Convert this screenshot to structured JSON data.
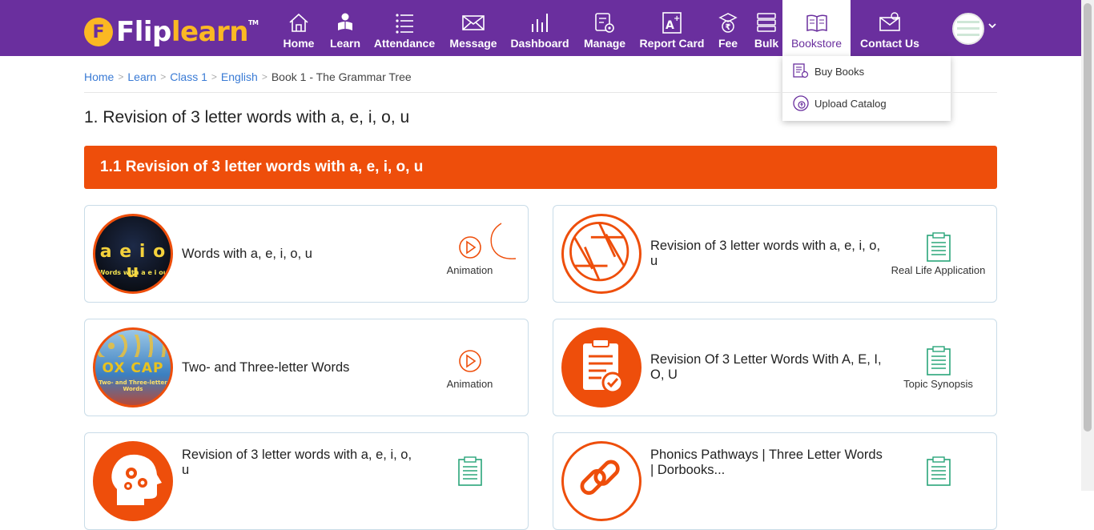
{
  "brand": {
    "flip": "Flip",
    "learn": "learn",
    "tm": "TM"
  },
  "nav": {
    "home": "Home",
    "learn": "Learn",
    "attendance": "Attendance",
    "message": "Message",
    "dashboard": "Dashboard",
    "manage": "Manage",
    "report_card": "Report Card",
    "fee": "Fee",
    "bulk": "Bulk",
    "bookstore": "Bookstore",
    "contact_us": "Contact Us"
  },
  "bookstore_menu": {
    "buy_books": "Buy Books",
    "upload_catalog": "Upload Catalog"
  },
  "breadcrumb": [
    "Home",
    "Learn",
    "Class 1",
    "English",
    "Book 1 - The Grammar Tree"
  ],
  "page_title": "1. Revision of 3 letter words with a, e, i, o, u",
  "section_title": "1.1 Revision of 3 letter words with a, e, i, o, u",
  "cards": [
    {
      "title": "Words with a, e, i, o, u",
      "action": "Animation",
      "thumb_letters": "a e i o u",
      "thumb_caption": "Words with a e i ou"
    },
    {
      "title": "Revision of 3 letter words with a, e, i, o, u",
      "action": "Real Life Application"
    },
    {
      "title": "Two- and Three-letter Words",
      "action": "Animation",
      "thumb_letters": "OX CAP",
      "thumb_caption": "Two- and Three-letter Words"
    },
    {
      "title": "Revision Of 3 Letter Words With A, E, I, O, U",
      "action": "Topic Synopsis"
    },
    {
      "title": "Revision of 3 letter words with a, e, i, o, u",
      "action": ""
    },
    {
      "title": "Phonics Pathways | Three Letter Words | Dorbooks...",
      "action": ""
    }
  ],
  "colors": {
    "nav_bg": "#6a2f9e",
    "accent_orange": "#ee4e0b",
    "link_blue": "#3a7bd5",
    "logo_yellow": "#fbb823",
    "doc_green": "#2aa57a"
  }
}
